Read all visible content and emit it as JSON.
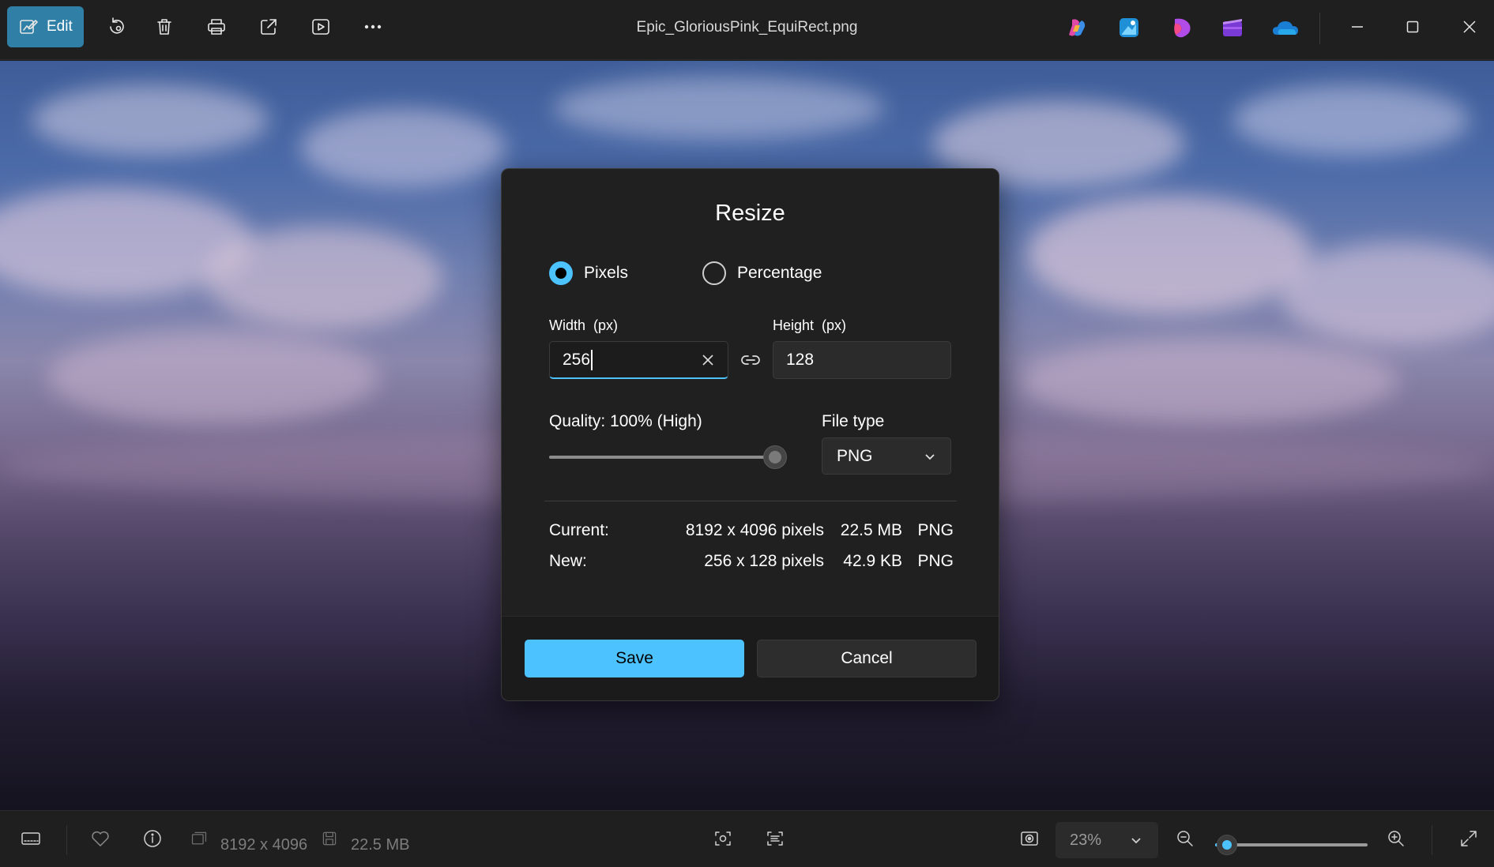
{
  "titlebar": {
    "edit_label": "Edit",
    "file_name": "Epic_GloriousPink_EquiRect.png",
    "tools": [
      "rotate-icon",
      "delete-icon",
      "print-icon",
      "share-icon",
      "slideshow-icon",
      "more-icon"
    ],
    "apps": [
      "copilot-icon",
      "designer-icon",
      "clipchamp-icon",
      "video-editor-icon",
      "onedrive-icon"
    ],
    "window_controls": [
      "minimize-icon",
      "maximize-icon",
      "close-icon"
    ]
  },
  "dialog": {
    "title": "Resize",
    "mode_pixels": "Pixels",
    "mode_percentage": "Percentage",
    "selected_mode": "Pixels",
    "width_label": "Width  (px)",
    "width_value": "256",
    "height_label": "Height  (px)",
    "height_value": "128",
    "quality_label": "Quality: 100% (High)",
    "quality_value": 100,
    "file_type_label": "File type",
    "file_type_value": "PNG",
    "current": {
      "label": "Current:",
      "dimensions": "8192 x 4096 pixels",
      "size": "22.5 MB",
      "type": "PNG"
    },
    "new": {
      "label": "New:",
      "dimensions": "256 x 128 pixels",
      "size": "42.9 KB",
      "type": "PNG"
    },
    "save_label": "Save",
    "cancel_label": "Cancel"
  },
  "statusbar": {
    "dimensions": "8192 x 4096",
    "file_size": "22.5 MB",
    "zoom_value": "23%",
    "zoom_fraction": 0.08
  },
  "colors": {
    "accent": "#4cc2ff",
    "edit_button": "#2f7fa6",
    "chrome_bg": "#1f1f1f",
    "dialog_bg": "#202020"
  }
}
